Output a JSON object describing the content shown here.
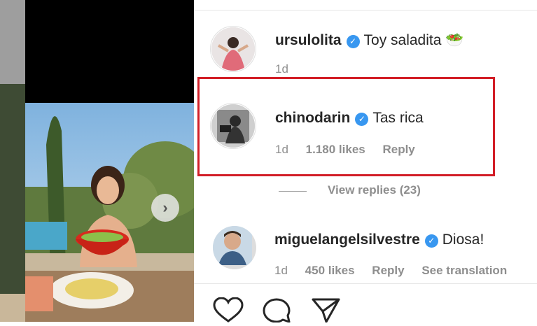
{
  "comments": [
    {
      "username": "ursulolita",
      "text": "Toy saladita 🥗",
      "time": "1d"
    },
    {
      "username": "chinodarin",
      "text": "Tas rica",
      "time": "1d",
      "likes": "1.180 likes",
      "reply": "Reply"
    },
    {
      "username": "miguelangelsilvestre",
      "text": "Diosa!",
      "time": "1d",
      "likes": "450 likes",
      "reply": "Reply",
      "translation": "See translation"
    }
  ],
  "view_replies": "View replies (23)",
  "next_icon": "chevron-right-icon",
  "actions": [
    "heart-icon",
    "comment-icon",
    "share-icon"
  ],
  "colors": {
    "highlight": "#d21e27",
    "verified": "#3897f0",
    "meta": "#8e8e8e"
  }
}
